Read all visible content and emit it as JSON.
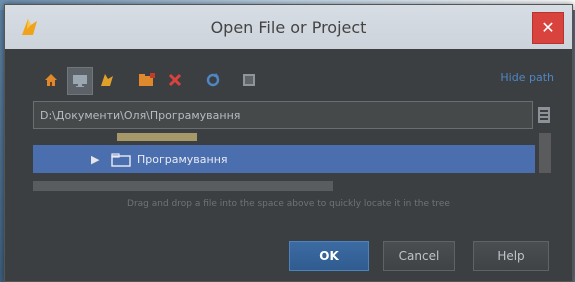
{
  "window": {
    "title": "Open File or Project",
    "close_symbol": "✕"
  },
  "toolbar": {
    "icons": [
      "home-icon",
      "desktop-icon",
      "project-icon",
      "new-folder-icon",
      "delete-icon",
      "refresh-icon",
      "show-hidden-icon"
    ],
    "hide_path_label": "Hide path"
  },
  "path": {
    "value": "D:\\Документи\\Оля\\Програмування"
  },
  "tree": {
    "selected_label": "Програмування"
  },
  "hint": "Drag and drop a file into the space above to quickly locate it in the tree",
  "buttons": {
    "ok": "OK",
    "cancel": "Cancel",
    "help": "Help"
  }
}
